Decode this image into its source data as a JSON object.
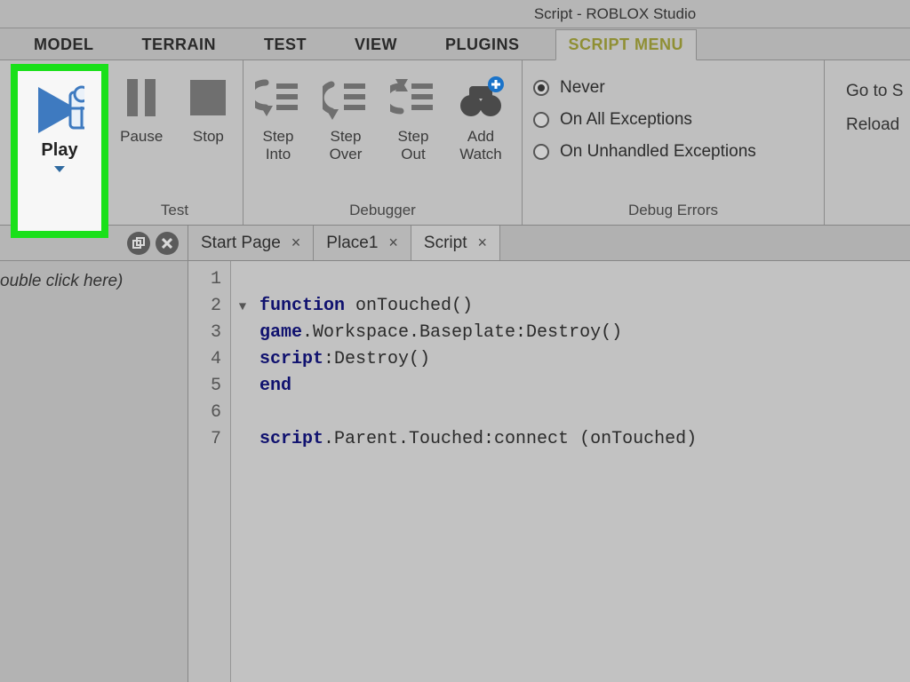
{
  "title": "Script - ROBLOX Studio",
  "menu": {
    "items": [
      "MODEL",
      "TERRAIN",
      "TEST",
      "VIEW",
      "PLUGINS",
      "SCRIPT MENU"
    ],
    "active": "SCRIPT MENU"
  },
  "ribbon": {
    "test": {
      "play": "Play",
      "pause": "Pause",
      "stop": "Stop",
      "footer": "Test"
    },
    "debugger": {
      "step_into": "Step\nInto",
      "step_over": "Step\nOver",
      "step_out": "Step\nOut",
      "add_watch": "Add\nWatch",
      "footer": "Debugger"
    },
    "errors": {
      "never": "Never",
      "all": "On All Exceptions",
      "unhandled": "On Unhandled Exceptions",
      "footer": "Debug Errors",
      "selected": "never"
    },
    "actions": {
      "goto": "Go to S",
      "reload": "Reload"
    }
  },
  "side": {
    "hint": "ouble click here)"
  },
  "doctabs": [
    {
      "label": "Start Page",
      "active": false
    },
    {
      "label": "Place1",
      "active": false
    },
    {
      "label": "Script",
      "active": true
    }
  ],
  "code": {
    "lines": [
      {
        "n": 1,
        "tokens": []
      },
      {
        "n": 2,
        "fold": true,
        "tokens": [
          [
            "kw",
            "function"
          ],
          [
            "nm",
            " onTouched()"
          ]
        ]
      },
      {
        "n": 3,
        "tokens": [
          [
            "kw",
            "game"
          ],
          [
            "nm",
            ".Workspace.Baseplate:Destroy()"
          ]
        ]
      },
      {
        "n": 4,
        "tokens": [
          [
            "kw",
            "script"
          ],
          [
            "nm",
            ":Destroy()"
          ]
        ]
      },
      {
        "n": 5,
        "tokens": [
          [
            "kw",
            "end"
          ]
        ]
      },
      {
        "n": 6,
        "tokens": []
      },
      {
        "n": 7,
        "tokens": [
          [
            "kw",
            "script"
          ],
          [
            "nm",
            ".Parent.Touched:connect (onTouched)"
          ]
        ]
      }
    ]
  }
}
